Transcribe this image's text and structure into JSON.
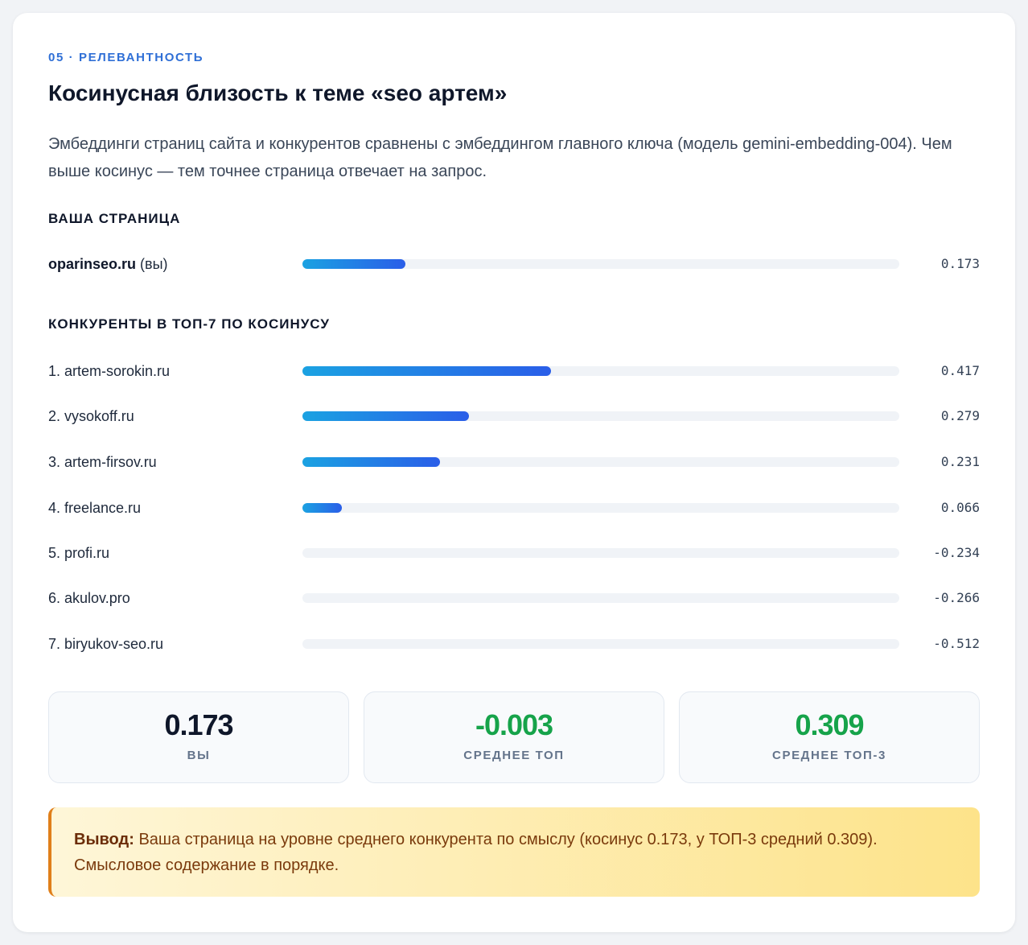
{
  "section": {
    "eyebrow": "05 · РЕЛЕВАНТНОСТЬ",
    "title": "Косинусная близость к теме «seo артем»",
    "description": "Эмбеддинги страниц сайта и конкурентов сравнены с эмбеддингом главного ключа (модель gemini-embedding-004). Чем выше косинус — тем точнее страница отвечает на запрос."
  },
  "your_page": {
    "heading": "ВАША СТРАНИЦА",
    "domain": "oparinseo.ru",
    "suffix": "(вы)",
    "value": 0.173,
    "value_text": "0.173"
  },
  "competitors": {
    "heading": "КОНКУРЕНТЫ В ТОП-7 ПО КОСИНУСУ",
    "items": [
      {
        "label": "1. artem-sorokin.ru",
        "value": 0.417,
        "value_text": "0.417"
      },
      {
        "label": "2. vysokoff.ru",
        "value": 0.279,
        "value_text": "0.279"
      },
      {
        "label": "3. artem-firsov.ru",
        "value": 0.231,
        "value_text": "0.231"
      },
      {
        "label": "4. freelance.ru",
        "value": 0.066,
        "value_text": "0.066"
      },
      {
        "label": "5. profi.ru",
        "value": -0.234,
        "value_text": "-0.234"
      },
      {
        "label": "6. akulov.pro",
        "value": -0.266,
        "value_text": "-0.266"
      },
      {
        "label": "7. biryukov-seo.ru",
        "value": -0.512,
        "value_text": "-0.512"
      }
    ]
  },
  "bar_scale": {
    "min": 0,
    "max": 1
  },
  "stats": [
    {
      "value": "0.173",
      "label": "ВЫ",
      "color": "#0f172a"
    },
    {
      "value": "-0.003",
      "label": "СРЕДНЕЕ ТОП",
      "color": "#16a34a"
    },
    {
      "value": "0.309",
      "label": "СРЕДНЕЕ ТОП-3",
      "color": "#16a34a"
    }
  ],
  "conclusion": {
    "lead": "Вывод:",
    "text": "Ваша страница на уровне среднего конкурента по смыслу (косинус 0.173, у ТОП-3 средний 0.309). Смысловое содержание в порядке."
  },
  "colors": {
    "accent": "#2f6fd6",
    "bar_start": "#1ba2e2",
    "bar_end": "#2a5ee8",
    "positive": "#16a34a",
    "warning_border": "#e07f1a"
  }
}
